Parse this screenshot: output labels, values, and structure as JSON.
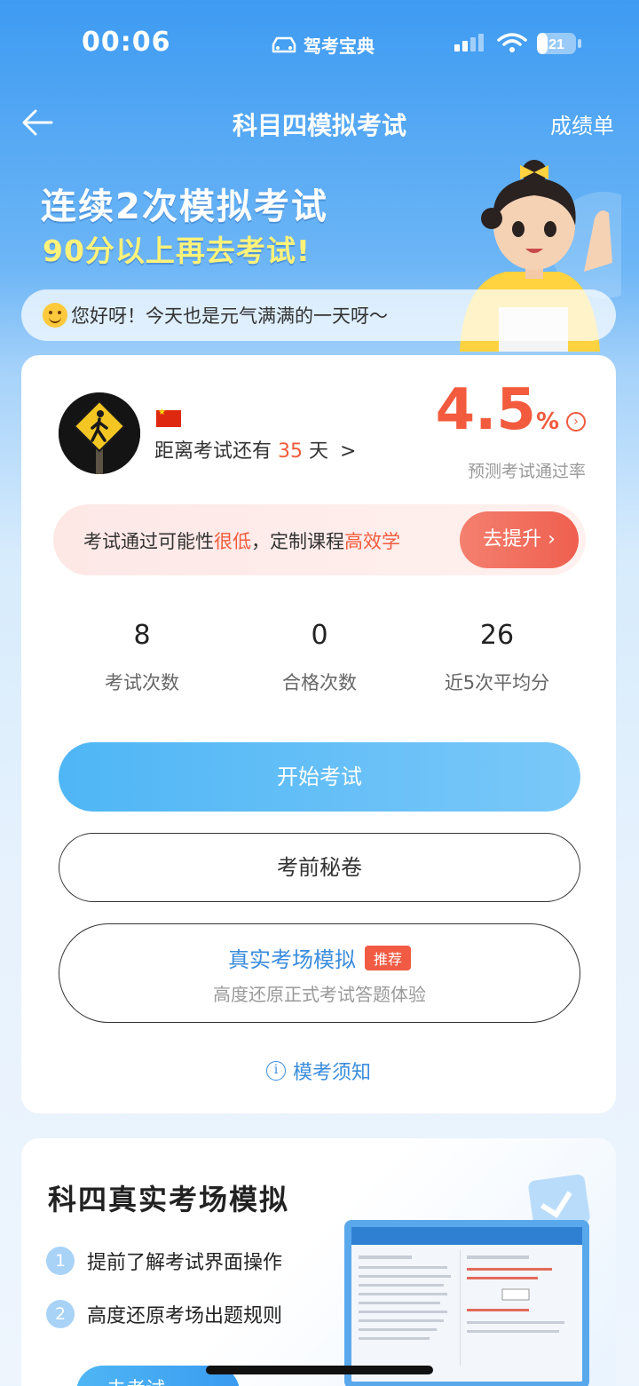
{
  "status_bar": {
    "time": "00:06",
    "carrier": "驾考宝典",
    "battery": "21"
  },
  "nav": {
    "title": "科目四模拟考试",
    "right_label": "成绩单"
  },
  "hero": {
    "line1": "连续2次模拟考试",
    "line2": "90分以上再去考试!"
  },
  "greeting": "您好呀！今天也是元气满满的一天呀～",
  "profile": {
    "countdown_prefix": "距离考试还有",
    "countdown_days": "35",
    "countdown_suffix": "天",
    "chevron": ">"
  },
  "pass_rate": {
    "value": "4.5",
    "unit": "%",
    "label": "预测考试通过率"
  },
  "warning": {
    "text1": "考试通过可能性",
    "hi1": "很低",
    "text2": "，定制课程",
    "hi2": "高效学",
    "button": "去提升"
  },
  "stats": [
    {
      "value": "8",
      "label": "考试次数"
    },
    {
      "value": "0",
      "label": "合格次数"
    },
    {
      "value": "26",
      "label": "近5次平均分"
    }
  ],
  "buttons": {
    "start": "开始考试",
    "secret": "考前秘卷",
    "real_title": "真实考场模拟",
    "real_badge": "推荐",
    "real_sub": "高度还原正式考试答题体验"
  },
  "notice": "模考须知",
  "simulation_card": {
    "title": "科四真实考场模拟",
    "features": [
      {
        "num": "1",
        "text": "提前了解考试界面操作"
      },
      {
        "num": "2",
        "text": "高度还原考场出题规则"
      }
    ],
    "go_button": "去考试"
  },
  "colors": {
    "accent_red": "#f25b3d",
    "accent_blue": "#3b8ddd",
    "button_blue": "#4fb6f5"
  }
}
